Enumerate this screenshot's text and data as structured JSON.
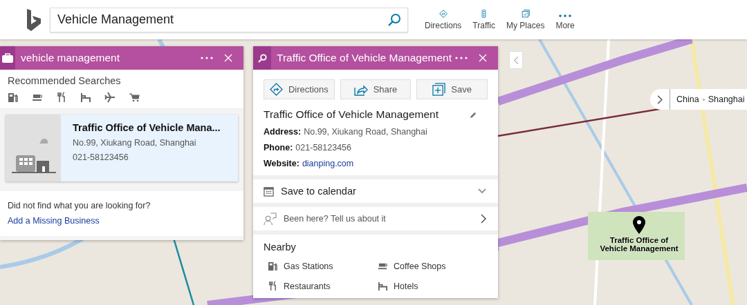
{
  "search": {
    "value": "Vehicle Management"
  },
  "toolbar": [
    {
      "label": "Directions",
      "kind": "directions"
    },
    {
      "label": "Traffic",
      "kind": "traffic"
    },
    {
      "label": "My Places",
      "kind": "places"
    },
    {
      "label": "More",
      "kind": "more"
    }
  ],
  "results_panel": {
    "title": "vehicle management",
    "heading": "Recommended Searches",
    "categories": [
      {
        "kind": "gas"
      },
      {
        "kind": "coffee"
      },
      {
        "kind": "food"
      },
      {
        "kind": "hotel"
      },
      {
        "kind": "plane"
      },
      {
        "kind": "cart"
      }
    ],
    "result": {
      "name": "Traffic Office of Vehicle Mana...",
      "address": "No.99, Xiukang Road, Shanghai",
      "phone": "021-58123456",
      "selected": true
    },
    "not_found": "Did not find what you are looking for?",
    "add_link": "Add a Missing Business"
  },
  "detail_panel": {
    "title": "Traffic Office of Vehicle Management",
    "actions": [
      {
        "label": "Directions",
        "kind": "directions"
      },
      {
        "label": "Share",
        "kind": "share"
      },
      {
        "label": "Save",
        "kind": "save"
      }
    ],
    "name": "Traffic Office of Vehicle Management",
    "fields": [
      {
        "label": "Address:",
        "value": "No.99, Xiukang Road, Shanghai",
        "kind": "text"
      },
      {
        "label": "Phone:",
        "value": "021-58123456",
        "kind": "text"
      },
      {
        "label": "Website:",
        "value": "dianping.com",
        "kind": "link"
      }
    ],
    "calendar": {
      "label": "Save to calendar",
      "expanded": false
    },
    "feedback": "Been here? Tell us about it",
    "nearby": {
      "heading": "Nearby",
      "items": [
        {
          "label": "Gas Stations",
          "kind": "gas"
        },
        {
          "label": "Coffee Shops",
          "kind": "coffee"
        },
        {
          "label": "Restaurants",
          "kind": "food"
        },
        {
          "label": "Hotels",
          "kind": "hotel"
        }
      ]
    }
  },
  "map": {
    "breadcrumb": [
      "China",
      "Shanghai"
    ],
    "pin_label": "Traffic Office of Vehicle Management"
  }
}
